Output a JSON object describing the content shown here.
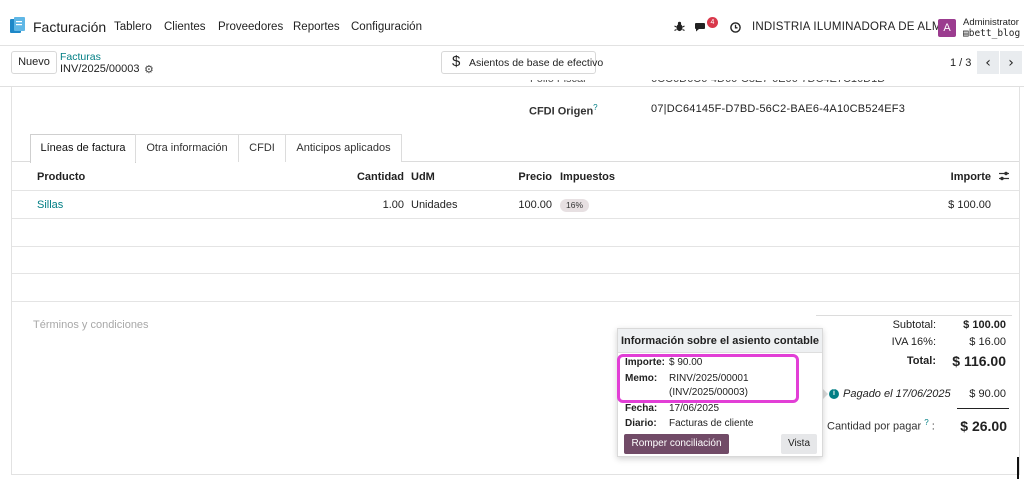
{
  "navbar": {
    "app_name": "Facturación",
    "menu": [
      "Tablero",
      "Clientes",
      "Proveedores",
      "Reportes",
      "Configuración"
    ],
    "bug_icon": "bug-icon",
    "chat_icon": "chat-icon",
    "chat_badge": "4",
    "clock_icon": "clock-icon",
    "company": "INDISTRIA ILUMINADORA DE ALM...",
    "avatar_letter": "A",
    "avatar_color": "#9b3c8f",
    "user_name": "Administrator",
    "user_db": "bett_blog"
  },
  "control_panel": {
    "new_button": "Nuevo",
    "breadcrumb_parent": "Facturas",
    "breadcrumb_current": "INV/2025/00003",
    "cash_basis_button": "Asientos de base de efectivo",
    "pager": "1 / 3"
  },
  "header_fields": {
    "cfdi_origin_label": "CFDI Origen",
    "cfdi_origin_value": "07|DC64145F-D7BD-56C2-BAE6-4A10CB524EF3"
  },
  "tabs": [
    "Líneas de factura",
    "Otra información",
    "CFDI",
    "Anticipos aplicados"
  ],
  "lines_table": {
    "headers": {
      "product": "Producto",
      "quantity": "Cantidad",
      "uom": "UdM",
      "price": "Precio",
      "taxes": "Impuestos",
      "amount": "Importe"
    },
    "rows": [
      {
        "product": "Sillas",
        "quantity": "1.00",
        "uom": "Unidades",
        "price": "100.00",
        "tax": "16%",
        "amount": "$ 100.00"
      }
    ]
  },
  "terms_placeholder": "Términos y condiciones",
  "totals": {
    "subtotal_label": "Subtotal:",
    "subtotal": "$ 100.00",
    "iva_label": "IVA 16%:",
    "iva": "$ 16.00",
    "total_label": "Total:",
    "total": "$ 116.00",
    "paid_label": "Pagado el 17/06/2025",
    "paid": "$ 90.00",
    "due_label": "Cantidad por pagar",
    "due_suffix": ":",
    "due": "$ 26.00"
  },
  "popover": {
    "title": "Información sobre el asiento contable",
    "amount_label": "Importe:",
    "amount": "$ 90.00",
    "memo_label": "Memo:",
    "memo_line1": "RINV/2025/00001",
    "memo_line2": "(INV/2025/00003)",
    "date_label": "Fecha:",
    "date": "17/06/2025",
    "journal_label": "Diario:",
    "journal": "Facturas de cliente",
    "unreconcile_button": "Romper conciliación",
    "view_button": "Vista"
  },
  "colors": {
    "brand": "#714b67",
    "link": "#017e84",
    "highlight": "#e23fd6",
    "badge": "#d9384b"
  }
}
